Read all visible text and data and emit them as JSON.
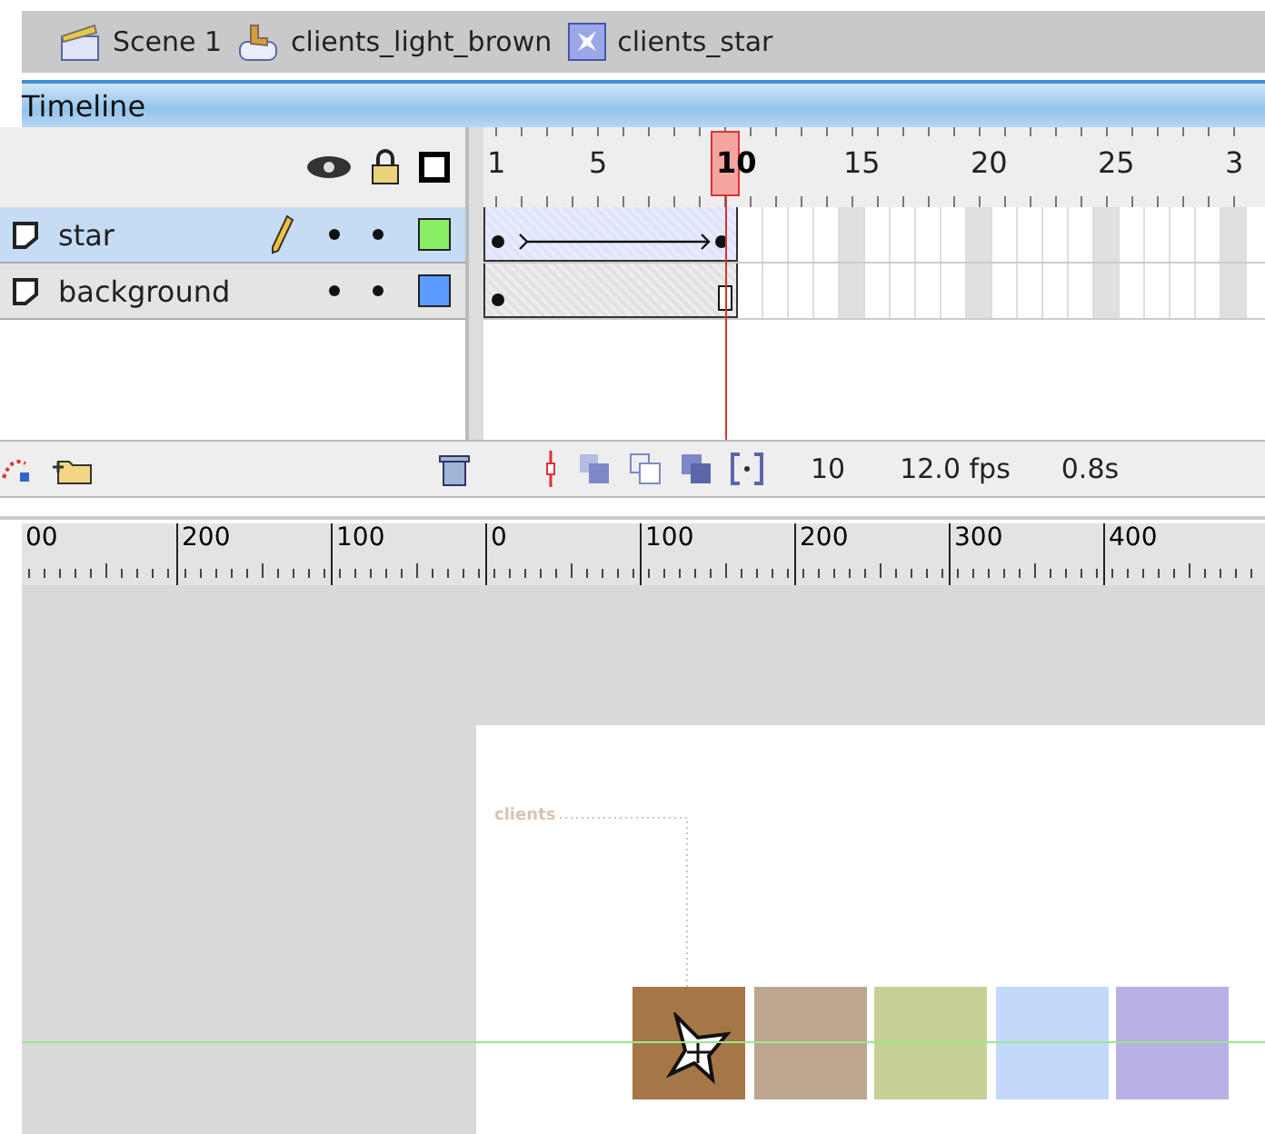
{
  "breadcrumb": [
    {
      "kind": "scene",
      "label": "Scene 1"
    },
    {
      "kind": "button",
      "label": "clients_light_brown"
    },
    {
      "kind": "graphic",
      "label": "clients_star"
    }
  ],
  "timeline": {
    "title": "Timeline",
    "frame_labels": [
      {
        "label": "1",
        "selected": false
      },
      {
        "label": "5",
        "selected": false
      },
      {
        "label": "10",
        "selected": true
      },
      {
        "label": "15",
        "selected": false
      },
      {
        "label": "20",
        "selected": false
      },
      {
        "label": "25",
        "selected": false
      },
      {
        "label": "3",
        "selected": false
      }
    ],
    "layers": [
      {
        "name": "star",
        "selected": true,
        "editing": true,
        "color": "#88ee66",
        "kind": "motion-tween"
      },
      {
        "name": "background",
        "selected": false,
        "editing": false,
        "color": "#5b9cff",
        "kind": "static"
      }
    ],
    "status": {
      "current_frame": "10",
      "frame_rate": "12.0 fps",
      "elapsed": "0.8s"
    }
  },
  "stage": {
    "ruler_labels": [
      "00",
      "200",
      "100",
      "0",
      "100",
      "200",
      "300",
      "400"
    ],
    "label": "clients",
    "squares": [
      {
        "color": "#a57747"
      },
      {
        "color": "#bca690"
      },
      {
        "color": "#c5d196"
      },
      {
        "color": "#c2d9fc"
      },
      {
        "color": "#b9b0e6"
      }
    ]
  }
}
